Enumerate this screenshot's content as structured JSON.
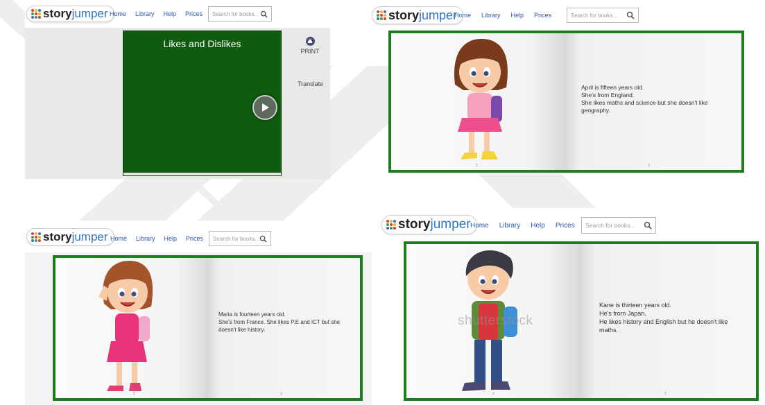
{
  "brand": {
    "logo_primary": "story",
    "logo_secondary": "jumper",
    "accent": "#2f74bd",
    "book_border": "#1e7d1e",
    "cover_color": "#0f5b0f"
  },
  "nav": {
    "home": "Home",
    "library": "Library",
    "help": "Help",
    "prices": "Prices"
  },
  "search": {
    "placeholder": "Search for books..."
  },
  "cover": {
    "title": "Likes and Dislikes",
    "print_label": "PRINT",
    "translate_label": "Translate"
  },
  "pages": {
    "april": {
      "lines": [
        "April is fifteen years old.",
        "She's from England.",
        "She likes maths and science but she doesn't like",
        "geography."
      ],
      "left_num": "2",
      "right_num": "3"
    },
    "maria": {
      "lines": [
        "Maria is fourteen years old.",
        "She's from France. She likes P.E and ICT but she",
        "doesn't like history."
      ],
      "left_num": "2",
      "right_num": "3"
    },
    "kane": {
      "lines": [
        "Kane is thirteen years old.",
        "He's from Japan.",
        "He likes history and English but he doesn't like",
        "maths."
      ],
      "left_num": "2",
      "right_num": "3",
      "watermark": "shutterstock"
    }
  }
}
